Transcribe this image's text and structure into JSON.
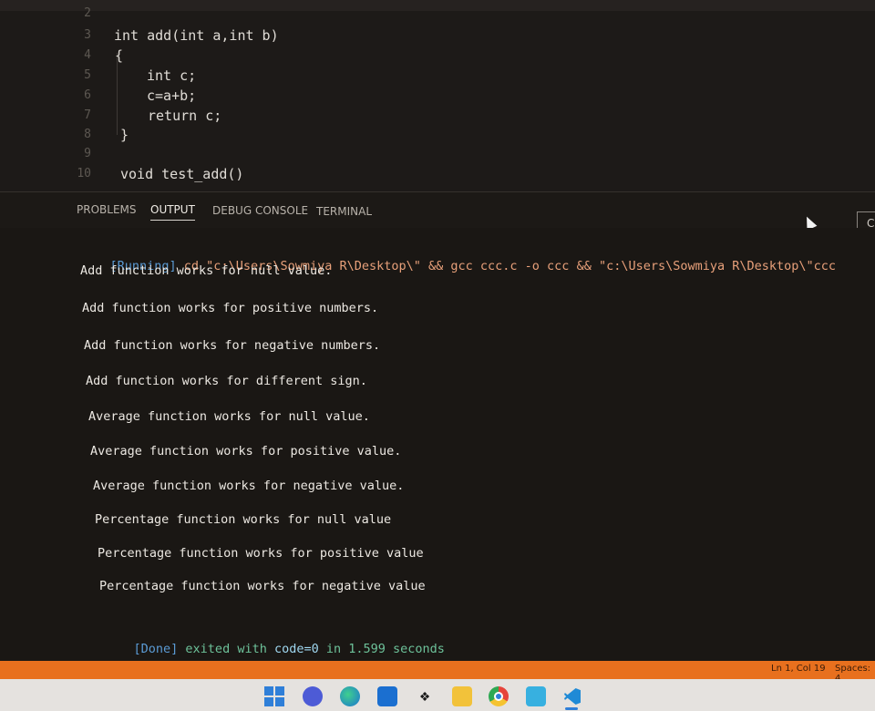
{
  "editor": {
    "lines": [
      {
        "num": "2",
        "text": ""
      },
      {
        "num": "3",
        "text": "int add(int a,int b)"
      },
      {
        "num": "4",
        "text": "{"
      },
      {
        "num": "5",
        "text": "int c;"
      },
      {
        "num": "6",
        "text": "c=a+b;"
      },
      {
        "num": "7",
        "text": "return c;"
      },
      {
        "num": "8",
        "text": "}"
      },
      {
        "num": "9",
        "text": ""
      },
      {
        "num": "10",
        "text": "void test_add()"
      }
    ]
  },
  "panel": {
    "tabs": [
      {
        "label": "PROBLEMS"
      },
      {
        "label": "OUTPUT"
      },
      {
        "label": "DEBUG CONSOLE"
      },
      {
        "label": "TERMINAL"
      }
    ],
    "active_tab": "OUTPUT",
    "right_button_label": "C"
  },
  "output": {
    "running_tag": "[Running]",
    "running_command": " cd \"c:\\Users\\Sowmiya R\\Desktop\\\" && gcc ccc.c -o ccc && \"c:\\Users\\Sowmiya R\\Desktop\\\"ccc",
    "lines": [
      "Add function works for null value.",
      "Add function works for positive numbers.",
      "Add function works for negative numbers.",
      "Add function works for different sign.",
      "Average function works for null value.",
      "Average function works for positive value.",
      "Average function works for negative value.",
      "Percentage function works for null value",
      "Percentage function works for positive value",
      "Percentage function works for negative value"
    ],
    "done_tag": "[Done]",
    "done_text_1": " exited with ",
    "done_code": "code=0",
    "done_text_2": " in 1.599 seconds"
  },
  "statusbar": {
    "position": "Ln 1, Col 19",
    "spaces": "Spaces: 4"
  },
  "taskbar": {
    "icons": [
      "windows-start-icon",
      "chat-icon",
      "edge-icon",
      "mail-icon",
      "dropbox-icon",
      "file-explorer-icon",
      "chrome-icon",
      "paint-icon",
      "vscode-icon"
    ]
  },
  "colors": {
    "statusbar": "#e8701e",
    "running_tag": "#5b9bd5",
    "command": "#e8a07a",
    "done_text": "#6dc29a"
  }
}
